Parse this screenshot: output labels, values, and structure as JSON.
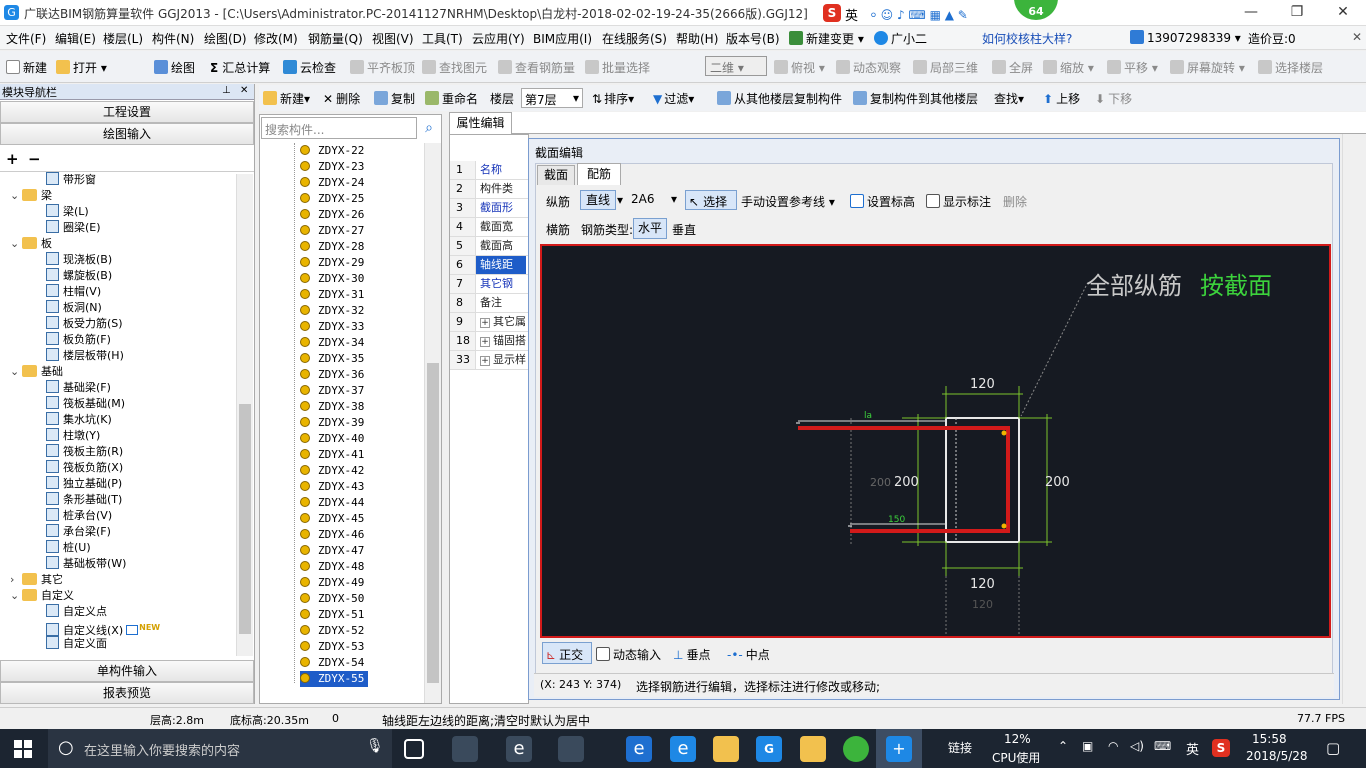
{
  "titlebar": {
    "title": "广联达BIM钢筋算量软件 GGJ2013 - [C:\\Users\\Administrator.PC-20141127NRHM\\Desktop\\白龙村-2018-02-02-19-24-35(2666版).GGJ12]",
    "ime_label": "英",
    "badge": "64",
    "min": "—",
    "max": "❐",
    "close": "✕"
  },
  "menubar": {
    "items": [
      "文件(F)",
      "编辑(E)",
      "楼层(L)",
      "构件(N)",
      "绘图(D)",
      "修改(M)",
      "钢筋量(Q)",
      "视图(V)",
      "工具(T)",
      "云应用(Y)",
      "BIM应用(I)",
      "在线服务(S)",
      "帮助(H)",
      "版本号(B)",
      "新建变更",
      "广小二"
    ],
    "help_link": "如何校核柱大样?",
    "phone": "13907298339",
    "price": "造价豆:0"
  },
  "toolbar1": {
    "items": [
      "新建",
      "打开",
      "绘图",
      "汇总计算",
      "云检查",
      "平齐板顶",
      "查找图元",
      "查看钢筋量",
      "批量选择",
      "二维",
      "俯视",
      "动态观察",
      "局部三维",
      "全屏",
      "缩放",
      "平移",
      "屏幕旋转",
      "选择楼层"
    ]
  },
  "nav": {
    "header": "模块导航栏",
    "btn_project": "工程设置",
    "btn_draw": "绘图输入",
    "btn_single": "单构件输入",
    "btn_report": "报表预览",
    "tree": [
      {
        "label": "带形窗",
        "level": 2,
        "kind": "item"
      },
      {
        "label": "梁",
        "level": 1,
        "kind": "folder"
      },
      {
        "label": "梁(L)",
        "level": 2,
        "kind": "item"
      },
      {
        "label": "圈梁(E)",
        "level": 2,
        "kind": "item"
      },
      {
        "label": "板",
        "level": 1,
        "kind": "folder"
      },
      {
        "label": "现浇板(B)",
        "level": 2,
        "kind": "item"
      },
      {
        "label": "螺旋板(B)",
        "level": 2,
        "kind": "item"
      },
      {
        "label": "柱帽(V)",
        "level": 2,
        "kind": "item"
      },
      {
        "label": "板洞(N)",
        "level": 2,
        "kind": "item"
      },
      {
        "label": "板受力筋(S)",
        "level": 2,
        "kind": "item"
      },
      {
        "label": "板负筋(F)",
        "level": 2,
        "kind": "item"
      },
      {
        "label": "楼层板带(H)",
        "level": 2,
        "kind": "item"
      },
      {
        "label": "基础",
        "level": 1,
        "kind": "folder"
      },
      {
        "label": "基础梁(F)",
        "level": 2,
        "kind": "item"
      },
      {
        "label": "筏板基础(M)",
        "level": 2,
        "kind": "item"
      },
      {
        "label": "集水坑(K)",
        "level": 2,
        "kind": "item"
      },
      {
        "label": "柱墩(Y)",
        "level": 2,
        "kind": "item"
      },
      {
        "label": "筏板主筋(R)",
        "level": 2,
        "kind": "item"
      },
      {
        "label": "筏板负筋(X)",
        "level": 2,
        "kind": "item"
      },
      {
        "label": "独立基础(P)",
        "level": 2,
        "kind": "item"
      },
      {
        "label": "条形基础(T)",
        "level": 2,
        "kind": "item"
      },
      {
        "label": "桩承台(V)",
        "level": 2,
        "kind": "item"
      },
      {
        "label": "承台梁(F)",
        "level": 2,
        "kind": "item"
      },
      {
        "label": "桩(U)",
        "level": 2,
        "kind": "item"
      },
      {
        "label": "基础板带(W)",
        "level": 2,
        "kind": "item"
      },
      {
        "label": "其它",
        "level": 1,
        "kind": "folder-collapsed"
      },
      {
        "label": "自定义",
        "level": 1,
        "kind": "folder"
      },
      {
        "label": "自定义点",
        "level": 2,
        "kind": "item"
      },
      {
        "label": "自定义线(X)",
        "level": 2,
        "kind": "item-new"
      },
      {
        "label": "自定义面",
        "level": 2,
        "kind": "item"
      }
    ],
    "new_badge": "NEW"
  },
  "toolbar2": {
    "items": [
      "新建",
      "删除",
      "复制",
      "重命名",
      "楼层",
      "第7层",
      "排序",
      "过滤",
      "从其他楼层复制构件",
      "复制构件到其他楼层",
      "查找",
      "上移",
      "下移"
    ]
  },
  "component_list": {
    "search_placeholder": "搜索构件...",
    "items": [
      "ZDYX-22",
      "ZDYX-23",
      "ZDYX-24",
      "ZDYX-25",
      "ZDYX-26",
      "ZDYX-27",
      "ZDYX-28",
      "ZDYX-29",
      "ZDYX-30",
      "ZDYX-31",
      "ZDYX-32",
      "ZDYX-33",
      "ZDYX-34",
      "ZDYX-35",
      "ZDYX-36",
      "ZDYX-37",
      "ZDYX-38",
      "ZDYX-39",
      "ZDYX-40",
      "ZDYX-41",
      "ZDYX-42",
      "ZDYX-43",
      "ZDYX-44",
      "ZDYX-45",
      "ZDYX-46",
      "ZDYX-47",
      "ZDYX-48",
      "ZDYX-49",
      "ZDYX-50",
      "ZDYX-51",
      "ZDYX-52",
      "ZDYX-53",
      "ZDYX-54",
      "ZDYX-55"
    ],
    "selected": "ZDYX-55"
  },
  "property": {
    "tab": "属性编辑",
    "rows": [
      {
        "num": "1",
        "label": "名称",
        "blue": true
      },
      {
        "num": "2",
        "label": "构件类",
        "blue": false
      },
      {
        "num": "3",
        "label": "截面形",
        "blue": true
      },
      {
        "num": "4",
        "label": "截面宽",
        "blue": false
      },
      {
        "num": "5",
        "label": "截面高",
        "blue": false
      },
      {
        "num": "6",
        "label": "轴线距",
        "blue": true,
        "selected": true
      },
      {
        "num": "7",
        "label": "其它钢",
        "blue": true
      },
      {
        "num": "8",
        "label": "备注",
        "blue": false
      },
      {
        "num": "9",
        "label": "其它属",
        "blue": false,
        "expand": true
      },
      {
        "num": "18",
        "label": "锚固搭",
        "blue": false,
        "expand": true
      },
      {
        "num": "33",
        "label": "显示样",
        "blue": false,
        "expand": true
      }
    ]
  },
  "section_dialog": {
    "title": "截面编辑",
    "tabs": [
      "截面",
      "配筋"
    ],
    "active_tab": "配筋",
    "row1": {
      "zongjin": "纵筋",
      "line": "直线",
      "spec": "2A6",
      "select": "选择",
      "manual": "手动设置参考线",
      "set_height": "设置标高",
      "show_mark": "显示标注",
      "delete": "删除"
    },
    "row2": {
      "hengjin": "横筋",
      "type_label": "钢筋类型:",
      "horizontal": "水平",
      "vertical": "垂直"
    },
    "canvas": {
      "annot_white": "全部纵筋",
      "annot_green": "按截面",
      "dim_top": "120",
      "dim_bottom": "120",
      "dim_bottom_gray": "120",
      "dim_left": "200",
      "dim_left_gray": "200",
      "dim_right": "200",
      "label_la": "la",
      "label_150": "150"
    },
    "bottom_tools": [
      "正交",
      "动态输入",
      "垂点",
      "中点"
    ],
    "coords": "(X: 243 Y: 374)",
    "hint": "选择钢筋进行编辑，选择标注进行修改或移动;"
  },
  "statusbar": {
    "floor_height": "层高:2.8m",
    "bottom_elev": "底标高:20.35m",
    "zero": "0",
    "message": "轴线距左边线的距离;清空时默认为居中",
    "fps": "77.7 FPS"
  },
  "taskbar": {
    "search_placeholder": "在这里输入你要搜索的内容",
    "link": "链接",
    "cpu_pct": "12%",
    "cpu_label": "CPU使用",
    "lang": "英",
    "time": "15:58",
    "date": "2018/5/28"
  },
  "colors": {
    "rebar": "#d21a1a",
    "canvas_bg": "#161a22",
    "dim_green": "#7cc42c",
    "annot_green": "#3cd23c",
    "selection_blue": "#1e5cc8"
  }
}
